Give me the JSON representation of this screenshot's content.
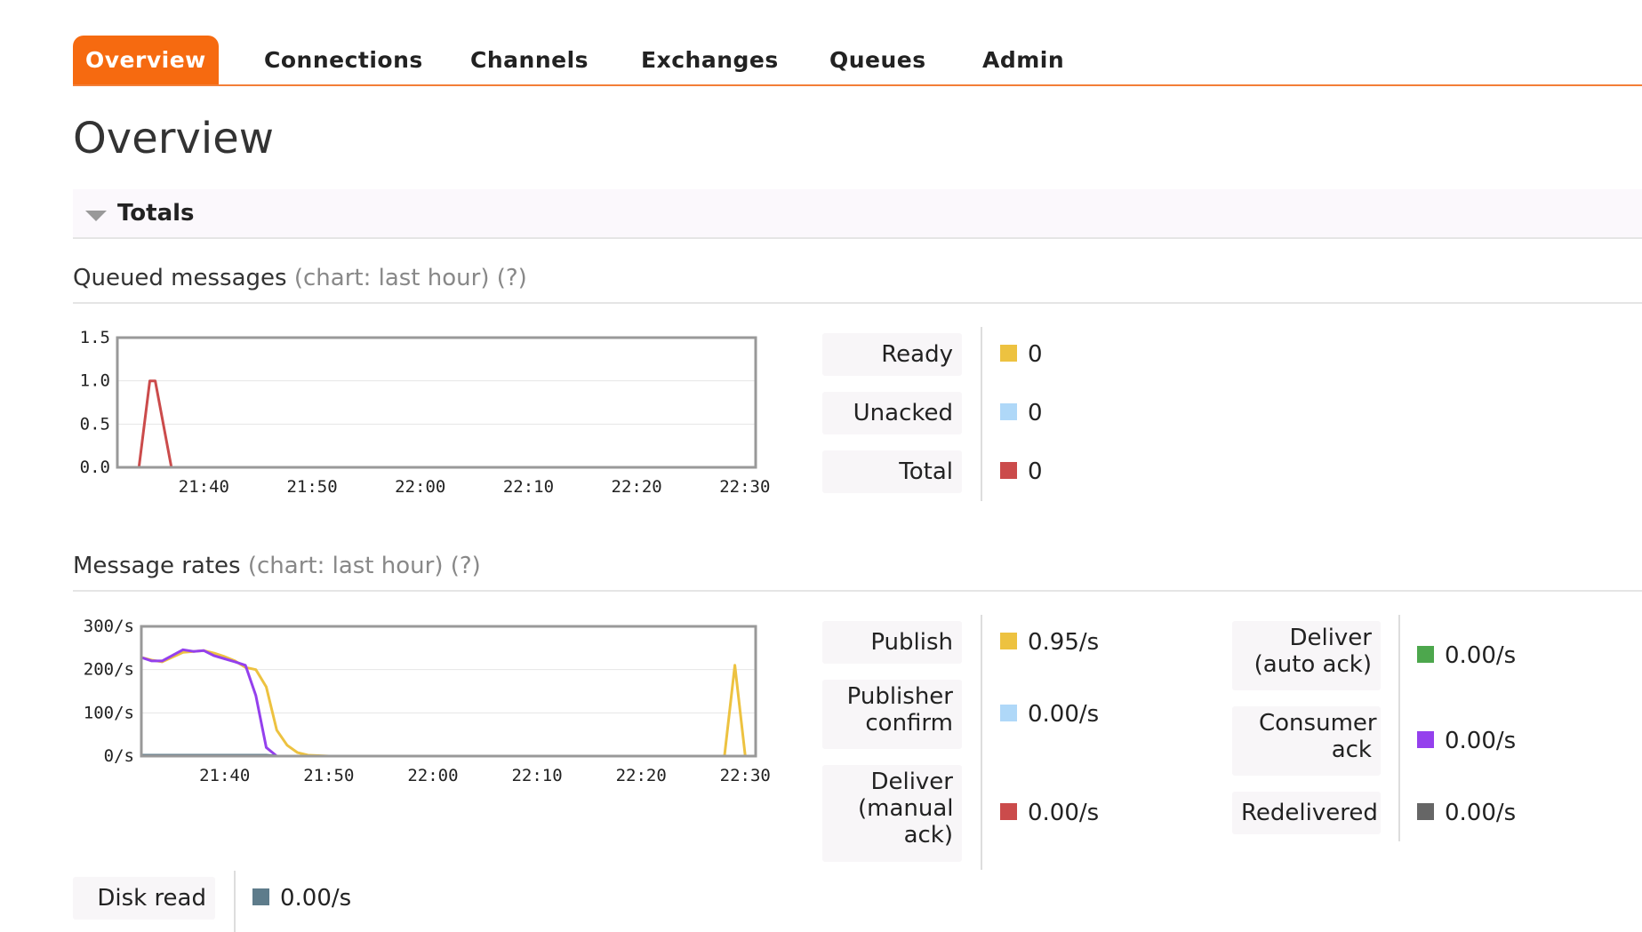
{
  "nav": {
    "tabs": [
      "Overview",
      "Connections",
      "Channels",
      "Exchanges",
      "Queues",
      "Admin"
    ],
    "active": "Overview"
  },
  "page_title": "Overview",
  "totals_section": {
    "label": "Totals"
  },
  "queued": {
    "heading": "Queued messages",
    "hint": "(chart: last hour) (?)",
    "stats": [
      {
        "label": "Ready",
        "value": "0",
        "color": "#edc240"
      },
      {
        "label": "Unacked",
        "value": "0",
        "color": "#afd8f8"
      },
      {
        "label": "Total",
        "value": "0",
        "color": "#cb4b4b"
      }
    ]
  },
  "rates": {
    "heading": "Message rates",
    "hint": "(chart: last hour) (?)",
    "stats_left": [
      {
        "label": "Publish",
        "value": "0.95/s",
        "color": "#edc240"
      },
      {
        "label": "Publisher confirm",
        "value": "0.00/s",
        "color": "#afd8f8"
      },
      {
        "label": "Deliver (manual ack)",
        "value": "0.00/s",
        "color": "#cb4b4b"
      }
    ],
    "stats_right": [
      {
        "label": "Deliver (auto ack)",
        "value": "0.00/s",
        "color": "#4da74d"
      },
      {
        "label": "Consumer ack",
        "value": "0.00/s",
        "color": "#9440ed"
      },
      {
        "label": "Redelivered",
        "value": "0.00/s",
        "color": "#666666"
      }
    ],
    "disk": {
      "label": "Disk read",
      "value": "0.00/s",
      "color": "#5e7c8b"
    }
  },
  "chart_data": [
    {
      "type": "line",
      "x_ticks": [
        "21:40",
        "21:50",
        "22:00",
        "22:10",
        "22:20",
        "22:30"
      ],
      "y_ticks": [
        "0.0",
        "0.5",
        "1.0",
        "1.5"
      ],
      "ylim": [
        0,
        1.5
      ],
      "xlim": [
        "21:32",
        "22:31"
      ],
      "grid": true,
      "series": [
        {
          "color": "#edc240",
          "x": [
            "21:32",
            "21:34",
            "21:35",
            "21:35.5",
            "21:37",
            "21:38",
            "22:31"
          ],
          "values": [
            0,
            0,
            0,
            0,
            0,
            0,
            0
          ]
        },
        {
          "color": "#cb4b4b",
          "x": [
            "21:32",
            "21:34",
            "21:35",
            "21:35.5",
            "21:37",
            "21:38",
            "22:31"
          ],
          "values": [
            0,
            0,
            1.0,
            1.0,
            0,
            0,
            0
          ]
        }
      ]
    },
    {
      "type": "line",
      "x_ticks": [
        "21:40",
        "21:50",
        "22:00",
        "22:10",
        "22:20",
        "22:30"
      ],
      "y_ticks": [
        "0/s",
        "100/s",
        "200/s",
        "300/s"
      ],
      "ylim": [
        0,
        300
      ],
      "xlim": [
        "21:32",
        "22:31"
      ],
      "grid": true,
      "series": [
        {
          "color": "#edc240",
          "x": [
            "21:32",
            "21:33",
            "21:34",
            "21:36",
            "21:37",
            "21:38",
            "21:39",
            "21:40",
            "21:41",
            "21:42",
            "21:43",
            "21:44",
            "21:45",
            "21:46",
            "21:47",
            "21:48",
            "21:50",
            "22:10",
            "22:20",
            "22:25",
            "22:28",
            "22:29",
            "22:30",
            "22:31"
          ],
          "values": [
            228,
            222,
            218,
            240,
            242,
            244,
            238,
            230,
            220,
            205,
            200,
            160,
            60,
            25,
            8,
            2,
            0,
            0,
            0,
            0,
            0,
            210,
            0,
            0
          ]
        },
        {
          "color": "#9440ed",
          "x": [
            "21:32",
            "21:33",
            "21:34",
            "21:36",
            "21:37",
            "21:38",
            "21:39",
            "21:40",
            "21:41",
            "21:42",
            "21:43",
            "21:44",
            "21:45",
            "21:46",
            "21:50",
            "22:31"
          ],
          "values": [
            228,
            220,
            220,
            246,
            242,
            244,
            232,
            225,
            218,
            210,
            140,
            20,
            0,
            0,
            0,
            0
          ]
        },
        {
          "color": "#5e7c8b",
          "x": [
            "21:32",
            "21:44",
            "21:45",
            "22:31"
          ],
          "values": [
            2,
            2,
            0,
            0
          ]
        }
      ]
    }
  ]
}
